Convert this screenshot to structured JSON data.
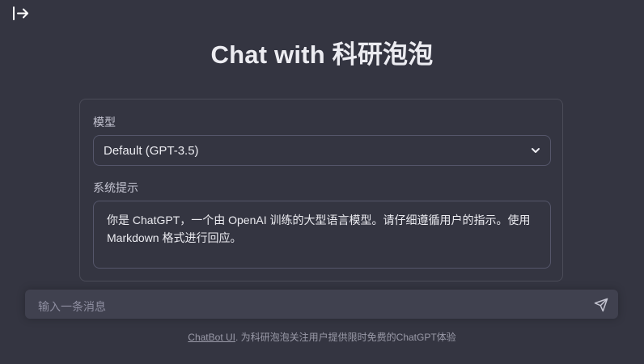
{
  "header": {
    "sidebar_toggle_icon": "expand-sidebar-icon",
    "title": "Chat with 科研泡泡"
  },
  "settings": {
    "model_label": "模型",
    "model_value": "Default (GPT-3.5)",
    "model_icon": "chevron-down-icon",
    "system_prompt_label": "系统提示",
    "system_prompt_value": "你是 ChatGPT，一个由 OpenAI 训练的大型语言模型。请仔细遵循用户的指示。使用 Markdown 格式进行回应。"
  },
  "chat_input": {
    "placeholder": "输入一条消息",
    "send_icon": "send-icon"
  },
  "footer": {
    "link_text": "ChatBot UI",
    "text": ". 为科研泡泡关注用户提供限时免费的ChatGPT体验"
  },
  "colors": {
    "background": "#343541",
    "input_background": "#40414f",
    "border": "#4b4c58",
    "text": "#ececf1",
    "muted_text": "#8e8ea0"
  }
}
